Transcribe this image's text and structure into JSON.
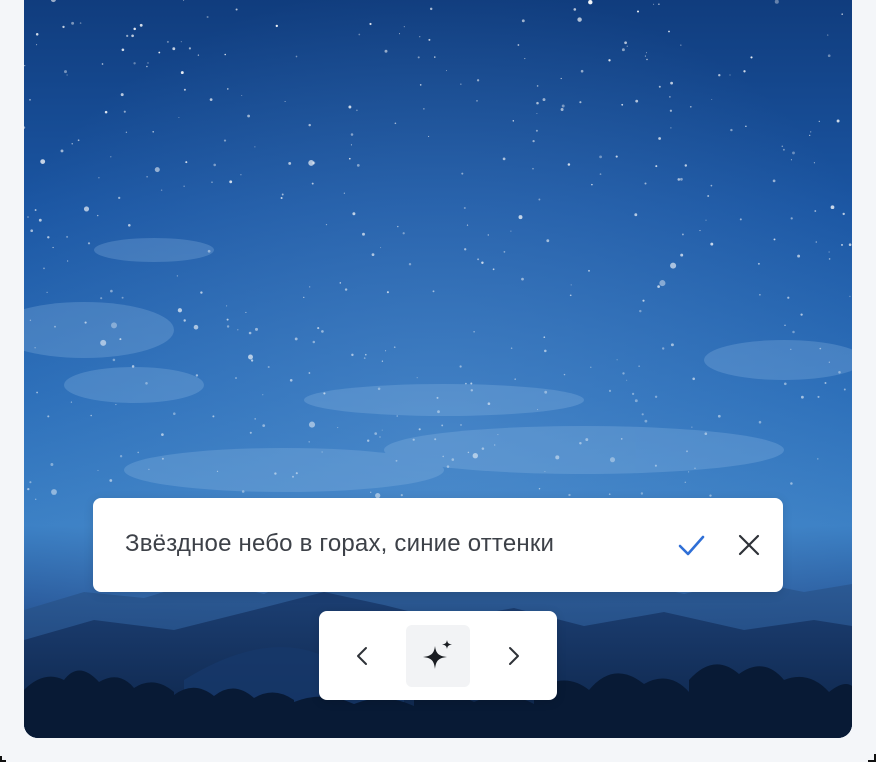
{
  "image": {
    "icon": "generated-image"
  },
  "prompt": {
    "text": "Звёздное небо в горах, синие оттенки",
    "confirm_icon": "check-icon",
    "cancel_icon": "close-icon",
    "accent_color": "#2f6fd6"
  },
  "toolbar": {
    "prev_icon": "chevron-left-icon",
    "generate_icon": "sparkle-icon",
    "next_icon": "chevron-right-icon"
  }
}
